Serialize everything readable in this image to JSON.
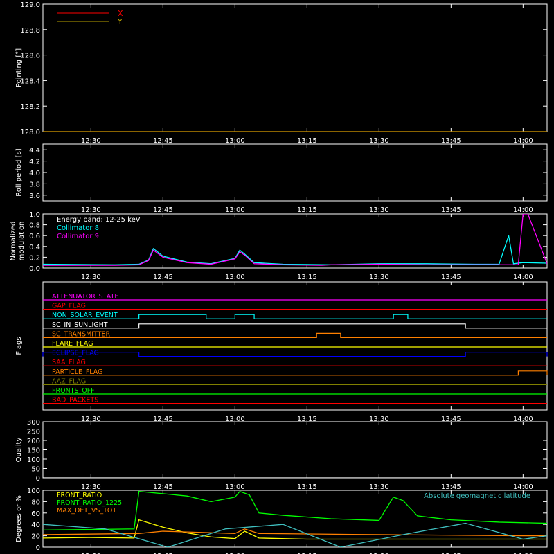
{
  "time_ticks": [
    "12:30",
    "12:45",
    "13:00",
    "13:15",
    "13:30",
    "13:45",
    "14:00"
  ],
  "chart_data": [
    {
      "id": "pointing",
      "type": "line",
      "ylabel": "Pointing [°]",
      "ylim": [
        128.0,
        129.0
      ],
      "yticks": [
        "128.0",
        "128.2",
        "128.4",
        "128.6",
        "128.8",
        "129.0"
      ],
      "legend": "top-left",
      "series": [
        {
          "name": "X",
          "color": "#ff0000",
          "x": [
            "12:20",
            "14:05"
          ],
          "y": [
            128.0,
            128.0
          ]
        },
        {
          "name": "Y",
          "color": "#b8a000",
          "x": [
            "12:20",
            "14:05"
          ],
          "y": [
            128.0,
            128.0
          ]
        }
      ]
    },
    {
      "id": "roll",
      "type": "line",
      "ylabel": "Roll period [s]",
      "ylim": [
        3.5,
        4.5
      ],
      "yticks": [
        "3.6",
        "3.8",
        "4.0",
        "4.2",
        "4.4"
      ],
      "series": []
    },
    {
      "id": "modulation",
      "type": "line",
      "ylabel": "Normalized modulation",
      "ylim": [
        0,
        1.0
      ],
      "yticks": [
        "0.0",
        "0.2",
        "0.4",
        "0.6",
        "0.8",
        "1.0"
      ],
      "legend": "top-left",
      "annotations": [
        "Energy band: 12-25 keV"
      ],
      "series": [
        {
          "name": "Collimator 8",
          "color": "#00ffff",
          "x": [
            "12:20",
            "12:35",
            "12:40",
            "12:42",
            "12:43",
            "12:45",
            "12:50",
            "12:55",
            "13:00",
            "13:01",
            "13:02",
            "13:04",
            "13:10",
            "13:20",
            "13:30",
            "13:40",
            "13:50",
            "13:55",
            "13:57",
            "13:58",
            "14:00",
            "14:05"
          ],
          "y": [
            0.07,
            0.06,
            0.07,
            0.15,
            0.36,
            0.22,
            0.11,
            0.08,
            0.18,
            0.33,
            0.26,
            0.1,
            0.07,
            0.06,
            0.08,
            0.08,
            0.07,
            0.07,
            0.6,
            0.08,
            0.1,
            0.09
          ]
        },
        {
          "name": "Collimator 9",
          "color": "#ff00ff",
          "x": [
            "12:20",
            "12:35",
            "12:40",
            "12:42",
            "12:43",
            "12:45",
            "12:50",
            "12:55",
            "13:00",
            "13:01",
            "13:02",
            "13:04",
            "13:10",
            "13:18",
            "13:20",
            "13:30",
            "13:40",
            "13:50",
            "13:59",
            "14:00",
            "14:01",
            "14:05"
          ],
          "y": [
            0.05,
            0.05,
            0.06,
            0.14,
            0.33,
            0.2,
            0.1,
            0.07,
            0.17,
            0.3,
            0.24,
            0.08,
            0.06,
            0.05,
            0.06,
            0.07,
            0.06,
            0.06,
            0.06,
            1.0,
            1.0,
            0.08
          ]
        }
      ]
    },
    {
      "id": "flags",
      "type": "line",
      "ylabel": "Flags",
      "series": [
        {
          "name": "ATTENUATOR_STATE",
          "color": "#ff00ff",
          "on": []
        },
        {
          "name": "GAP_FLAG",
          "color": "#ff0000",
          "on": []
        },
        {
          "name": "NON_SOLAR_EVENT",
          "color": "#00ffff",
          "on": [
            [
              "12:40",
              "12:54"
            ],
            [
              "13:00",
              "13:04"
            ],
            [
              "13:33",
              "13:36"
            ]
          ]
        },
        {
          "name": "SC_IN_SUNLIGHT",
          "color": "#ffffff",
          "on": [
            [
              "12:40",
              "13:48"
            ]
          ]
        },
        {
          "name": "SC_TRANSMITTER",
          "color": "#ff8000",
          "on": [
            [
              "13:17",
              "13:22"
            ]
          ]
        },
        {
          "name": "FLARE_FLAG",
          "color": "#ffff00",
          "on": []
        },
        {
          "name": "ECLIPSE_FLAG",
          "color": "#0000ff",
          "on": [
            [
              "12:20",
              "12:40"
            ],
            [
              "13:48",
              "14:05"
            ]
          ]
        },
        {
          "name": "SAA_FLAG",
          "color": "#ff0000",
          "on": []
        },
        {
          "name": "PARTICLE_FLAG",
          "color": "#ff8000",
          "on": [
            [
              "13:59",
              "14:05"
            ]
          ]
        },
        {
          "name": "AAZ_FLAG",
          "color": "#808000",
          "on": []
        },
        {
          "name": "FRONTS_OFF",
          "color": "#00ff00",
          "on": []
        },
        {
          "name": "BAD_PACKETS",
          "color": "#ff0000",
          "on": []
        }
      ]
    },
    {
      "id": "quality",
      "type": "line",
      "ylabel": "Quality",
      "ylim": [
        0,
        300
      ],
      "yticks": [
        "0",
        "50",
        "100",
        "150",
        "200",
        "250",
        "300"
      ],
      "series": [
        {
          "name": "quality",
          "color": "#ffffff",
          "x": [
            "12:20",
            "14:05"
          ],
          "y": [
            0,
            0
          ]
        }
      ]
    },
    {
      "id": "ratios",
      "type": "line",
      "ylabel": "Degrees or %",
      "ylim": [
        0,
        100
      ],
      "yticks": [
        "0",
        "20",
        "40",
        "60",
        "80",
        "100"
      ],
      "legend": "top-left",
      "annotations": [
        "Absolute geomagnetic latitude"
      ],
      "series": [
        {
          "name": "FRONT_RATIO",
          "color": "#ffff00",
          "x": [
            "12:20",
            "12:30",
            "12:39",
            "12:40",
            "12:45",
            "12:50",
            "12:55",
            "13:00",
            "13:02",
            "13:05",
            "13:15",
            "13:30",
            "13:45",
            "14:00",
            "14:05"
          ],
          "y": [
            16,
            17,
            16,
            48,
            35,
            25,
            18,
            15,
            28,
            16,
            14,
            14,
            14,
            14,
            14
          ]
        },
        {
          "name": "FRONT_RATIO_1225",
          "color": "#00ff00",
          "x": [
            "12:20",
            "12:39",
            "12:40",
            "12:50",
            "12:55",
            "13:00",
            "13:01",
            "13:03",
            "13:05",
            "13:10",
            "13:20",
            "13:30",
            "13:33",
            "13:35",
            "13:38",
            "13:45",
            "13:55",
            "14:05"
          ],
          "y": [
            30,
            32,
            98,
            90,
            80,
            88,
            98,
            92,
            60,
            56,
            50,
            47,
            88,
            82,
            55,
            48,
            44,
            42
          ]
        },
        {
          "name": "MAX_DET_VS_TOT",
          "color": "#ff8000",
          "x": [
            "12:20",
            "12:40",
            "12:45",
            "13:00",
            "13:02",
            "13:05",
            "13:30",
            "14:00",
            "14:05"
          ],
          "y": [
            22,
            24,
            28,
            24,
            32,
            24,
            22,
            20,
            20
          ]
        },
        {
          "name": "Absolute geomagnetic latitude",
          "color": "#40c0c0",
          "x": [
            "12:20",
            "12:33",
            "12:46",
            "12:58",
            "13:10",
            "13:22",
            "13:35",
            "13:48",
            "14:00",
            "14:05"
          ],
          "y": [
            40,
            32,
            0,
            32,
            40,
            0,
            22,
            42,
            14,
            20
          ]
        }
      ]
    }
  ]
}
